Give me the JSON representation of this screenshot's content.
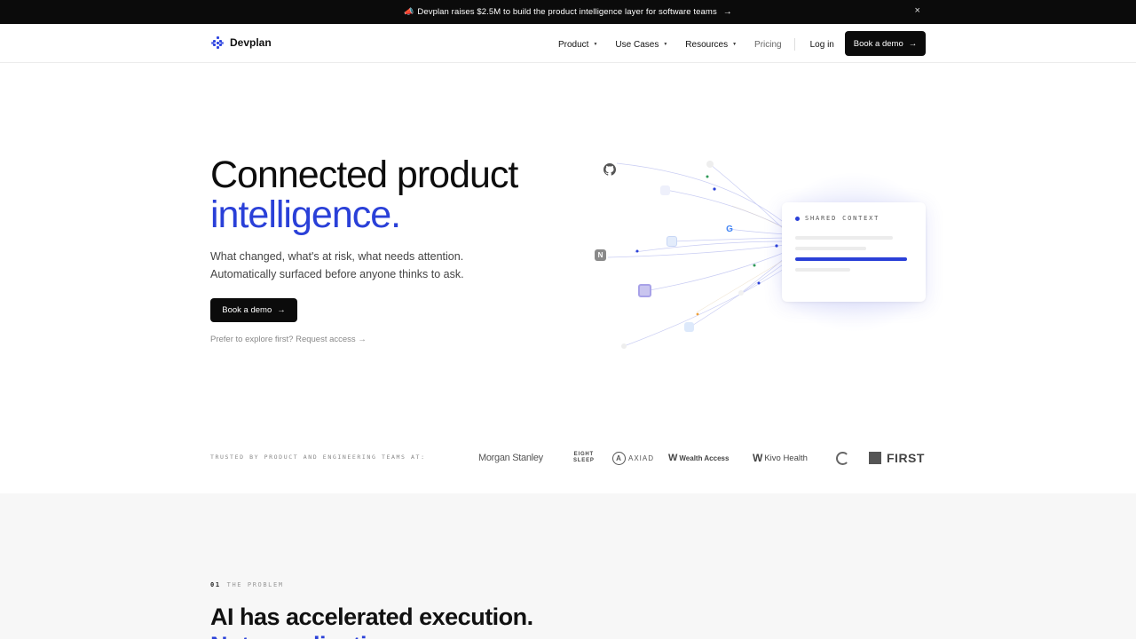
{
  "announcement": {
    "emoji": "📣",
    "text": "Devplan raises $2.5M to build the product intelligence layer for software teams",
    "arrow": "→",
    "close": "×"
  },
  "nav": {
    "brand": "Devplan",
    "links": [
      {
        "label": "Product",
        "caret": "▼"
      },
      {
        "label": "Use Cases",
        "caret": "▼"
      },
      {
        "label": "Resources",
        "caret": "▼"
      },
      {
        "label": "Pricing"
      }
    ],
    "login": "Log in",
    "cta": "Book a demo",
    "cta_arrow": "→"
  },
  "hero": {
    "title_line1": "Connected product",
    "title_line2": "intelligence.",
    "subtitle_line1": "What changed, what's at risk, what needs attention.",
    "subtitle_line2": "Automatically surfaced before anyone thinks to ask.",
    "cta": "Book a demo",
    "cta_arrow": "→",
    "secondary_link": "Prefer to explore first? Request access →"
  },
  "illustration": {
    "card_label": "SHARED CONTEXT",
    "notion_letter": "N",
    "google_letter": "G",
    "accent": "#2a40d8"
  },
  "trusted": {
    "label": "TRUSTED BY PRODUCT AND ENGINEERING TEAMS AT:",
    "brands": {
      "morgan": "Morgan Stanley",
      "eight_line1": "EIGHT",
      "eight_line2": "SLEEP",
      "axiad": "AXIAD",
      "wealth": "Wealth Access",
      "kivo": "Kivo Health",
      "first": "FIRST"
    }
  },
  "problem": {
    "number": "01",
    "eyebrow": "THE PROBLEM",
    "title_line1": "AI has accelerated execution.",
    "title_line2": "Not coordination."
  }
}
